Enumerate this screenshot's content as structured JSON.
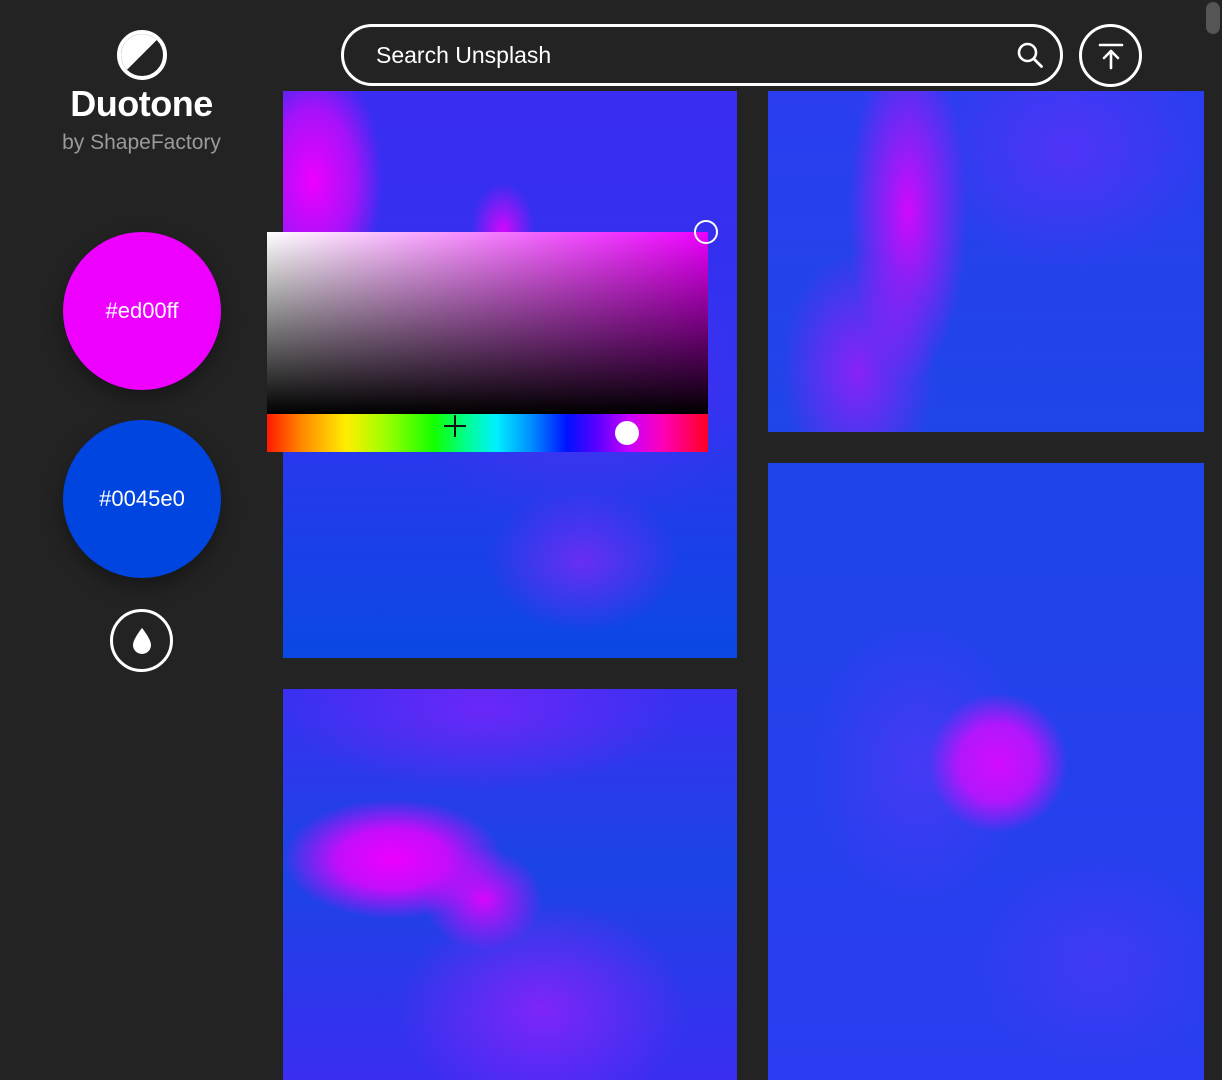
{
  "app": {
    "title": "Duotone",
    "byline": "by ShapeFactory"
  },
  "palette": {
    "light": {
      "label": "#ed00ff",
      "color": "#ed00ff"
    },
    "dark": {
      "label": "#0045e0",
      "color": "#0045e0"
    },
    "dropper_icon": "water-drop-icon"
  },
  "search": {
    "placeholder": "Search Unsplash",
    "value": "",
    "icon": "search-icon"
  },
  "actions": {
    "scroll_top_icon": "arrow-up-to-line-icon"
  },
  "color_picker": {
    "open": true,
    "target": "light",
    "selected_hue_color": "#ed00ff"
  },
  "photos": [
    {
      "id": "photo-1"
    },
    {
      "id": "photo-2"
    },
    {
      "id": "photo-3"
    },
    {
      "id": "photo-4"
    }
  ]
}
